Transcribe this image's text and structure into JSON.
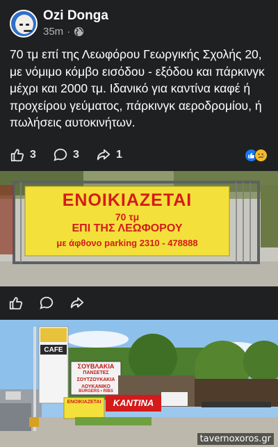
{
  "post": {
    "author": "Ozi Donga",
    "time": "35m",
    "privacy_icon": "globe-icon",
    "text": "70 τμ επί της Λεωφόρου Γεωργικής Σχολής 20, με νόμιμο κόμβο εισόδου - εξόδου και πάρκινγκ μέχρι και 2000 τμ. Ιδανικό για καντίνα καφέ ή προχείρου γεύματος, πάρκινγκ αεροδρομίου, ή πωλήσεις αυτοκινήτων."
  },
  "stats": {
    "likes": "3",
    "comments": "3",
    "shares": "1"
  },
  "photo1": {
    "banner_title": "ΕΝΟΙΚΙΑΖΕΤΑΙ",
    "banner_line2": "70 τμ",
    "banner_line3": "ΕΠΙ ΤΗΣ ΛΕΩΦΟΡΟΥ",
    "banner_line4": "με άφθονο parking 2310 - 478888"
  },
  "photo2": {
    "sign_cafe": "CAFE",
    "sign_food_line1": "ΣΟΥΒΛΑΚΙΑ",
    "sign_food_line2": "ΠΑΝΣΕΤΕΣ",
    "sign_food_line3": "ΣΟΥΤΖΟΥΚΑΚΙΑ",
    "sign_food_line4": "ΛΟΥΚΑΝΙΚΟ",
    "sign_burgers": "BURGERS • RIBS",
    "small_banner": "ΕΝΟΙΚΙΑΖΕΤΑΙ",
    "kantina_sign": "KANTINA",
    "watermark": "tavernoxoros.gr"
  },
  "colors": {
    "background": "#1f2021",
    "banner_yellow": "#f3e03a",
    "banner_red": "#d41b1b",
    "like_blue": "#1877f2"
  }
}
